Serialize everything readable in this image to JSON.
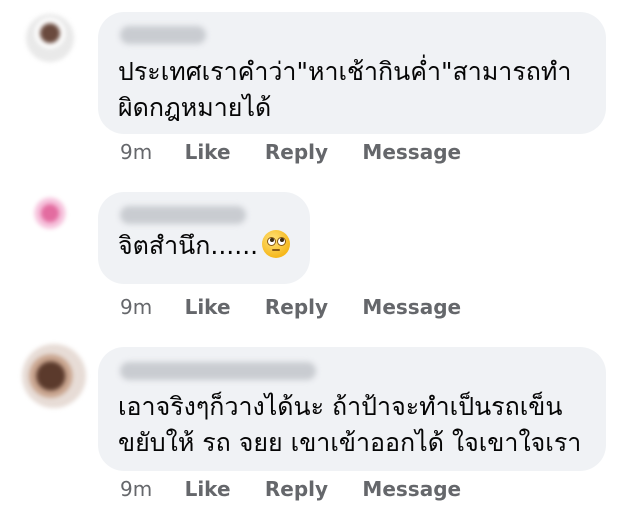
{
  "comments": [
    {
      "text_lines": [
        "ประเทศเราคำว่า\"หาเช้ากินค่ำ\"สามารถทำ",
        "ผิดกฎหมายได้"
      ],
      "time": "9m",
      "like": "Like",
      "reply": "Reply",
      "message": "Message"
    },
    {
      "text_lines": [
        "จิตสำนึก......"
      ],
      "emoji": "face-with-rolling-eyes-icon",
      "time": "9m",
      "like": "Like",
      "reply": "Reply",
      "message": "Message"
    },
    {
      "text_lines": [
        "เอาจริงๆก็วางได้นะ ถ้าป้าจะทำเป็นรถเข็น",
        "ขยับให้ รถ จยย เขาเข้าออกได้ ใจเขาใจเรา"
      ],
      "time": "9m",
      "like": "Like",
      "reply": "Reply",
      "message": "Message"
    }
  ],
  "colors": {
    "bubble_bg": "#f0f2f5",
    "text": "#050505",
    "meta": "#65676b"
  }
}
